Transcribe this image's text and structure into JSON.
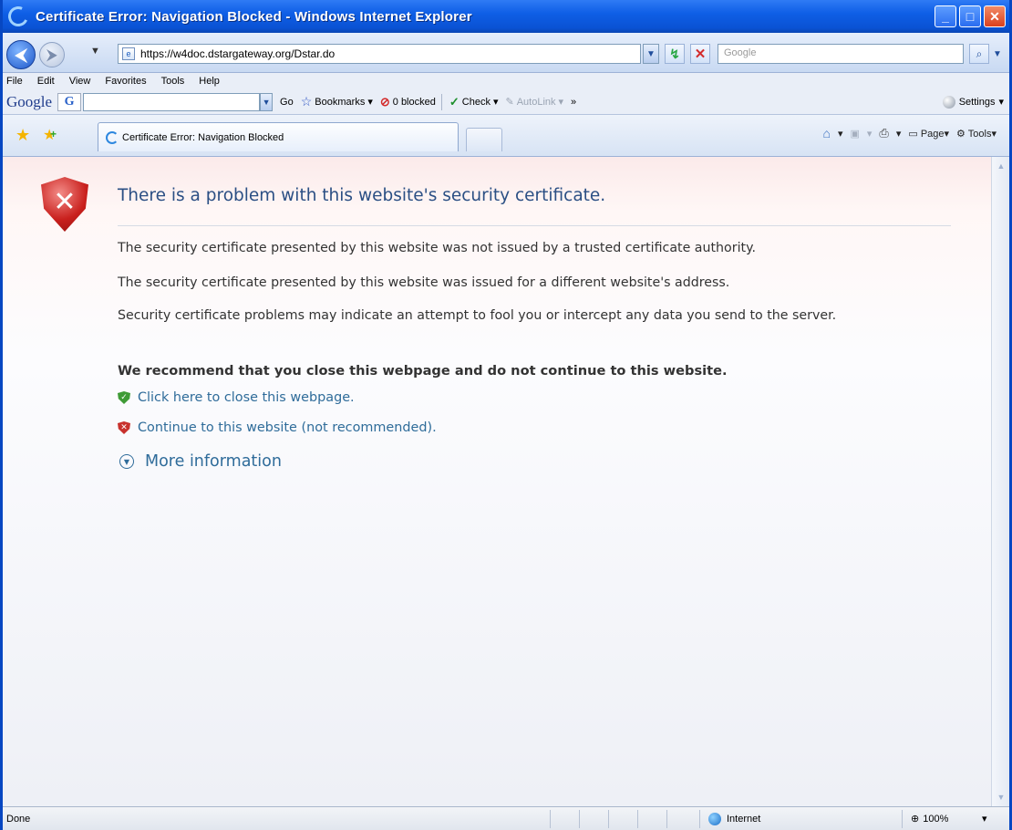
{
  "window": {
    "title": "Certificate Error: Navigation Blocked - Windows Internet Explorer",
    "controls": {
      "minimize": "_",
      "maximize": "□",
      "close": "✕"
    }
  },
  "address_bar": {
    "url": "https://w4doc.dstargateway.org/Dstar.do",
    "search_placeholder": "Google"
  },
  "menu": [
    "File",
    "Edit",
    "View",
    "Favorites",
    "Tools",
    "Help"
  ],
  "google_toolbar": {
    "logo": "Google",
    "g_button": "G",
    "go": "Go",
    "bookmarks": "Bookmarks",
    "blocked": "0 blocked",
    "check": "Check",
    "autolink": "AutoLink",
    "more": "»",
    "settings": "Settings"
  },
  "tab": {
    "label": "Certificate Error: Navigation Blocked"
  },
  "command_bar": {
    "page": "Page",
    "tools": "Tools"
  },
  "content": {
    "title": "There is a problem with this website's security certificate.",
    "para1": "The security certificate presented by this website was not issued by a trusted certificate authority.",
    "para2": "The security certificate presented by this website was issued for a different website's address.",
    "para3": "Security certificate problems may indicate an attempt to fool you or intercept any data you send to the server.",
    "recommend": "We recommend that you close this webpage and do not continue to this website.",
    "close_link": "Click here to close this webpage.",
    "continue_link": "Continue to this website (not recommended).",
    "more_info": "More information"
  },
  "status_bar": {
    "status": "Done",
    "zone": "Internet",
    "zoom": "100%"
  },
  "colors": {
    "title_bar": "#0f5fe6",
    "link": "#2f6c9a",
    "error_red": "#c9201d"
  },
  "icons": [
    "ie-logo-icon",
    "back-icon",
    "forward-icon",
    "refresh-icon",
    "stop-icon",
    "search-icon",
    "favorites-star-icon",
    "add-favorite-icon",
    "home-icon",
    "feeds-icon",
    "print-icon",
    "page-icon",
    "tools-icon",
    "error-shield-icon",
    "green-shield-icon",
    "red-shield-icon",
    "expand-icon",
    "globe-icon",
    "zoom-icon"
  ]
}
